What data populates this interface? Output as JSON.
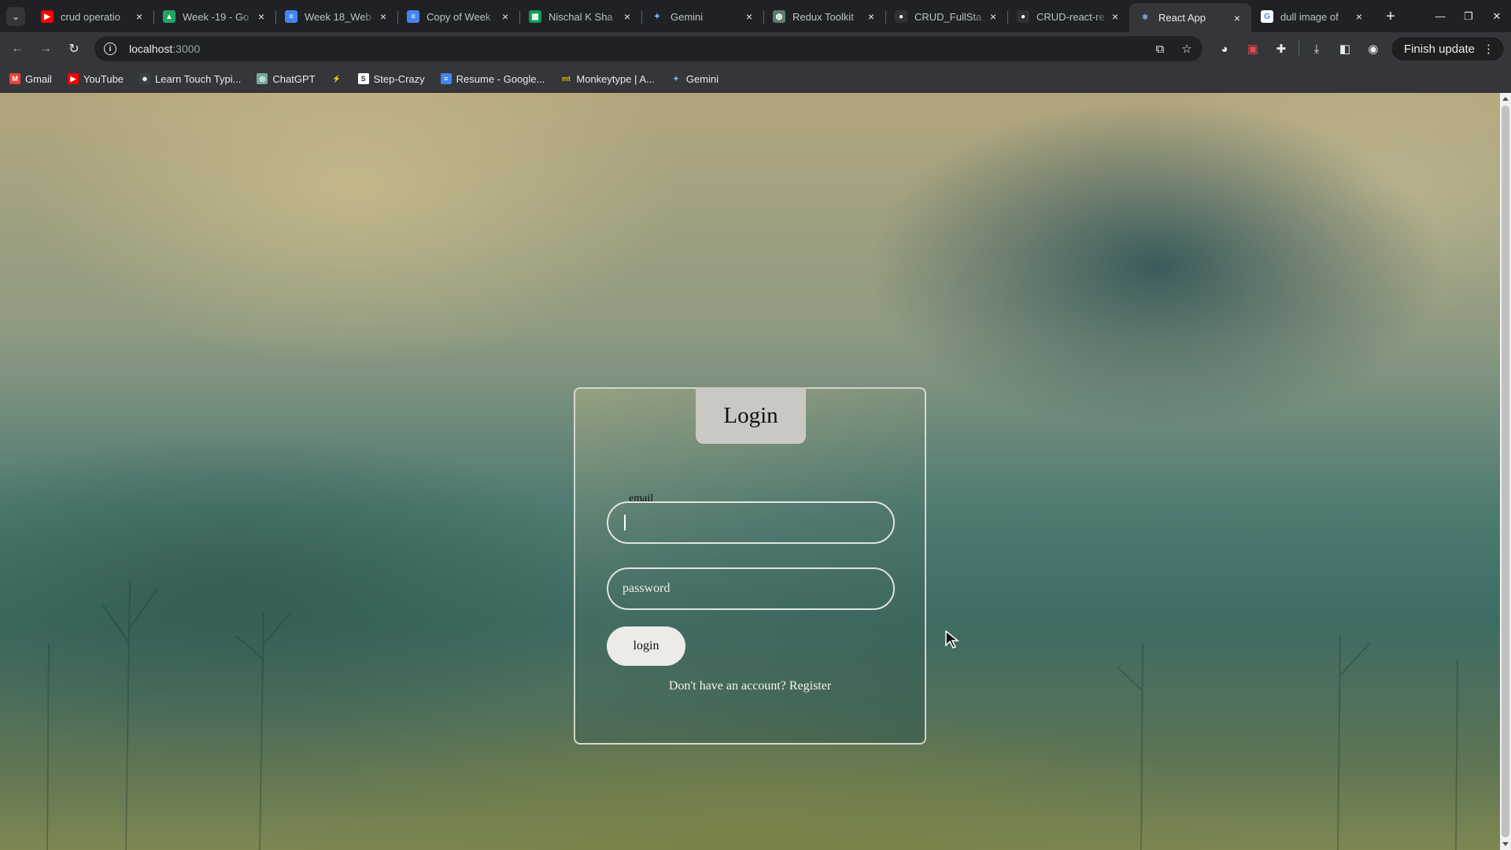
{
  "colors": {
    "tabstrip_bg": "#202124",
    "toolbar_bg": "#35363a",
    "card_border": "#e6e6dc",
    "title_box_bg": "#c9c8c2",
    "button_bg": "#ecebe7"
  },
  "browser": {
    "tabs": [
      {
        "title": "crud operatio",
        "favicon": "youtube-icon",
        "fav_color": "#ff0000",
        "fav_glyph": "▶"
      },
      {
        "title": "Week -19 - Go",
        "favicon": "drive-icon",
        "fav_color": "#1fa463",
        "fav_glyph": "▲"
      },
      {
        "title": "Week 18_Web",
        "favicon": "docs-icon",
        "fav_color": "#4285f4",
        "fav_glyph": "≡"
      },
      {
        "title": "Copy of Week",
        "favicon": "docs-icon",
        "fav_color": "#4285f4",
        "fav_glyph": "≡"
      },
      {
        "title": "Nischal K Sha",
        "favicon": "sheets-icon",
        "fav_color": "#0f9d58",
        "fav_glyph": "▦"
      },
      {
        "title": "Gemini",
        "favicon": "gemini-icon",
        "fav_color": "transparent",
        "fav_glyph": "✦"
      },
      {
        "title": "Redux Toolkit",
        "favicon": "redux-icon",
        "fav_color": "#5a7e6e",
        "fav_glyph": "◍"
      },
      {
        "title": "CRUD_FullSta",
        "favicon": "github-icon",
        "fav_color": "#303134",
        "fav_glyph": "●"
      },
      {
        "title": "CRUD-react-re",
        "favicon": "github-icon",
        "fav_color": "#303134",
        "fav_glyph": "●"
      },
      {
        "title": "React App",
        "favicon": "react-icon",
        "fav_color": "transparent",
        "fav_glyph": "⚛",
        "active": true
      },
      {
        "title": "dull image of",
        "favicon": "google-icon",
        "fav_color": "#ffffff",
        "fav_glyph": "G"
      }
    ],
    "url": "localhost",
    "url_port": ":3000",
    "finish_update": "Finish update",
    "bookmarks": [
      {
        "label": "Gmail",
        "icon": "gmail-icon",
        "color": "#ea4335",
        "glyph": "M"
      },
      {
        "label": "YouTube",
        "icon": "youtube-icon",
        "color": "#ff0000",
        "glyph": "▶"
      },
      {
        "label": "Learn Touch Typi...",
        "icon": "typing-icon",
        "color": "#3c4043",
        "glyph": "☻"
      },
      {
        "label": "ChatGPT",
        "icon": "chatgpt-icon",
        "color": "#74aa9c",
        "glyph": "◎"
      },
      {
        "label": "",
        "icon": "bolt-icon",
        "color": "transparent",
        "glyph": "⚡"
      },
      {
        "label": "Step-Crazy",
        "icon": "stepcrazy-icon",
        "color": "#ffffff",
        "glyph": "S"
      },
      {
        "label": "Resume - Google...",
        "icon": "docs-icon",
        "color": "#4285f4",
        "glyph": "≡"
      },
      {
        "label": "Monkeytype | A...",
        "icon": "monkeytype-icon",
        "color": "transparent",
        "glyph": "mt"
      },
      {
        "label": "Gemini",
        "icon": "gemini-icon",
        "color": "transparent",
        "glyph": "✦"
      }
    ]
  },
  "login": {
    "title": "Login",
    "email_label": "email",
    "email_value": "",
    "password_placeholder": "password",
    "button": "login",
    "register_text": "Don't have an account?",
    "register_link": "Register"
  }
}
